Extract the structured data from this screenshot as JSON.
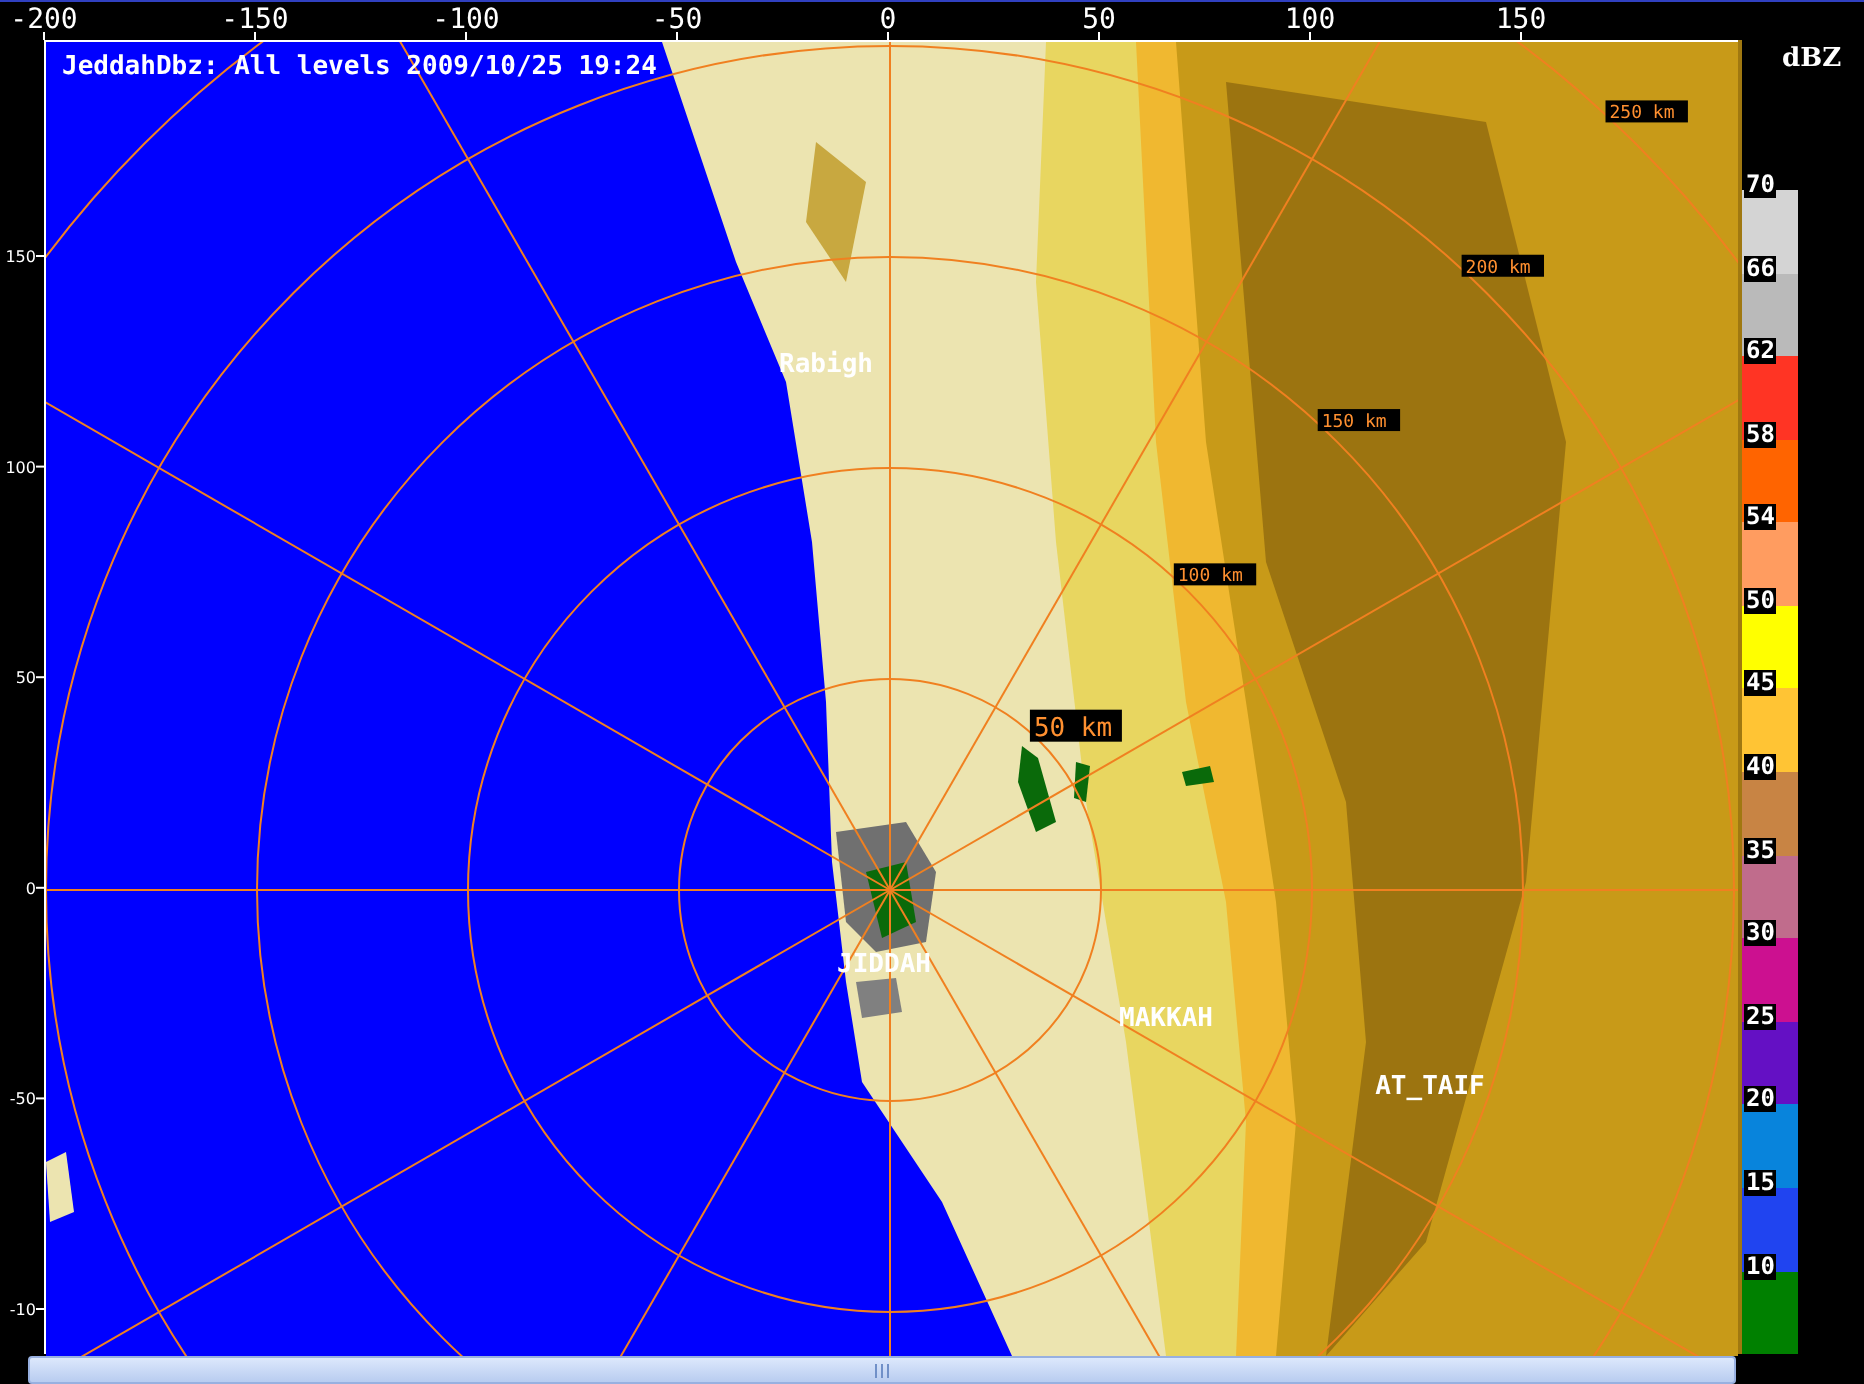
{
  "top_axis": {
    "ticks": [
      "-200",
      "-150",
      "-100",
      "-50",
      "0",
      "50",
      "100",
      "150"
    ]
  },
  "left_axis": {
    "ticks": [
      "150",
      "100",
      "50",
      "0",
      "-50",
      "-10"
    ]
  },
  "map": {
    "title": "JeddahDbz: All levels 2009/10/25 19:24",
    "range_rings": [
      {
        "label": "50 km"
      },
      {
        "label": "100 km"
      },
      {
        "label": "150 km"
      },
      {
        "label": "200 km"
      },
      {
        "label": "250 km"
      }
    ],
    "cities": [
      {
        "name": "Rabigh"
      },
      {
        "name": "JIDDAH"
      },
      {
        "name": "MAKKAH"
      },
      {
        "name": "AT_TAIF"
      }
    ]
  },
  "legend": {
    "unit": "dBZ",
    "bins": [
      {
        "label": "70",
        "color": "#d4d4d4"
      },
      {
        "label": "66",
        "color": "#bababa"
      },
      {
        "label": "62",
        "color": "#ff3424"
      },
      {
        "label": "58",
        "color": "#ff6400"
      },
      {
        "label": "54",
        "color": "#ff9c60"
      },
      {
        "label": "50",
        "color": "#ffff00"
      },
      {
        "label": "45",
        "color": "#ffc434"
      },
      {
        "label": "40",
        "color": "#c88444"
      },
      {
        "label": "35",
        "color": "#c06c8c"
      },
      {
        "label": "30",
        "color": "#cc1090"
      },
      {
        "label": "25",
        "color": "#6410c4"
      },
      {
        "label": "20",
        "color": "#0884dc"
      },
      {
        "label": "15",
        "color": "#2044f0"
      },
      {
        "label": "10",
        "color": "#008000"
      }
    ]
  }
}
